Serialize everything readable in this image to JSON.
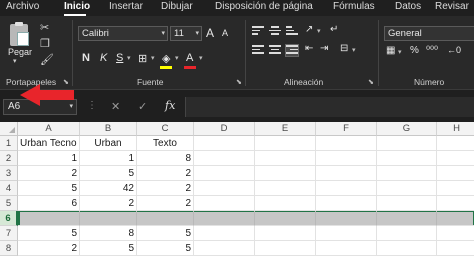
{
  "menu": {
    "tabs": [
      "Archivo",
      "Inicio",
      "Insertar",
      "Dibujar",
      "Disposición de página",
      "Fórmulas",
      "Datos",
      "Revisar"
    ],
    "active": "Inicio"
  },
  "ribbon": {
    "clipboard": {
      "paste_label": "Pegar",
      "group_label": "Portapapeles"
    },
    "font": {
      "name": "Calibri",
      "size": "11",
      "group_label": "Fuente",
      "bold": "N",
      "italic": "K",
      "underline": "S",
      "grow": "A",
      "shrink": "A",
      "font_color_letter": "A"
    },
    "alignment": {
      "group_label": "Alineación"
    },
    "number": {
      "format": "General",
      "group_label": "Número"
    }
  },
  "formula_bar": {
    "name_box": "A6",
    "fx": "fx",
    "cancel": "✕",
    "enter": "✓",
    "value": ""
  },
  "grid": {
    "columns": [
      "A",
      "B",
      "C",
      "D",
      "E",
      "F",
      "G",
      "H"
    ],
    "rows": [
      {
        "row": "1",
        "cells": [
          "Urban Tecno",
          "Urban",
          "Texto",
          "",
          "",
          "",
          "",
          ""
        ]
      },
      {
        "row": "2",
        "cells": [
          "1",
          "1",
          "8",
          "",
          "",
          "",
          "",
          ""
        ]
      },
      {
        "row": "3",
        "cells": [
          "2",
          "5",
          "2",
          "",
          "",
          "",
          "",
          ""
        ]
      },
      {
        "row": "4",
        "cells": [
          "5",
          "42",
          "2",
          "",
          "",
          "",
          "",
          ""
        ]
      },
      {
        "row": "5",
        "cells": [
          "6",
          "2",
          "2",
          "",
          "",
          "",
          "",
          ""
        ]
      },
      {
        "row": "6",
        "cells": [
          "",
          "",
          "",
          "",
          "",
          "",
          "",
          ""
        ]
      },
      {
        "row": "7",
        "cells": [
          "5",
          "8",
          "5",
          "",
          "",
          "",
          "",
          ""
        ]
      },
      {
        "row": "8",
        "cells": [
          "2",
          "5",
          "5",
          "",
          "",
          "",
          "",
          ""
        ]
      }
    ],
    "selected_row": "6"
  },
  "colors": {
    "accent": "#217346",
    "arrow": "#e8252b",
    "selection_fill": "#c6c6c6"
  }
}
